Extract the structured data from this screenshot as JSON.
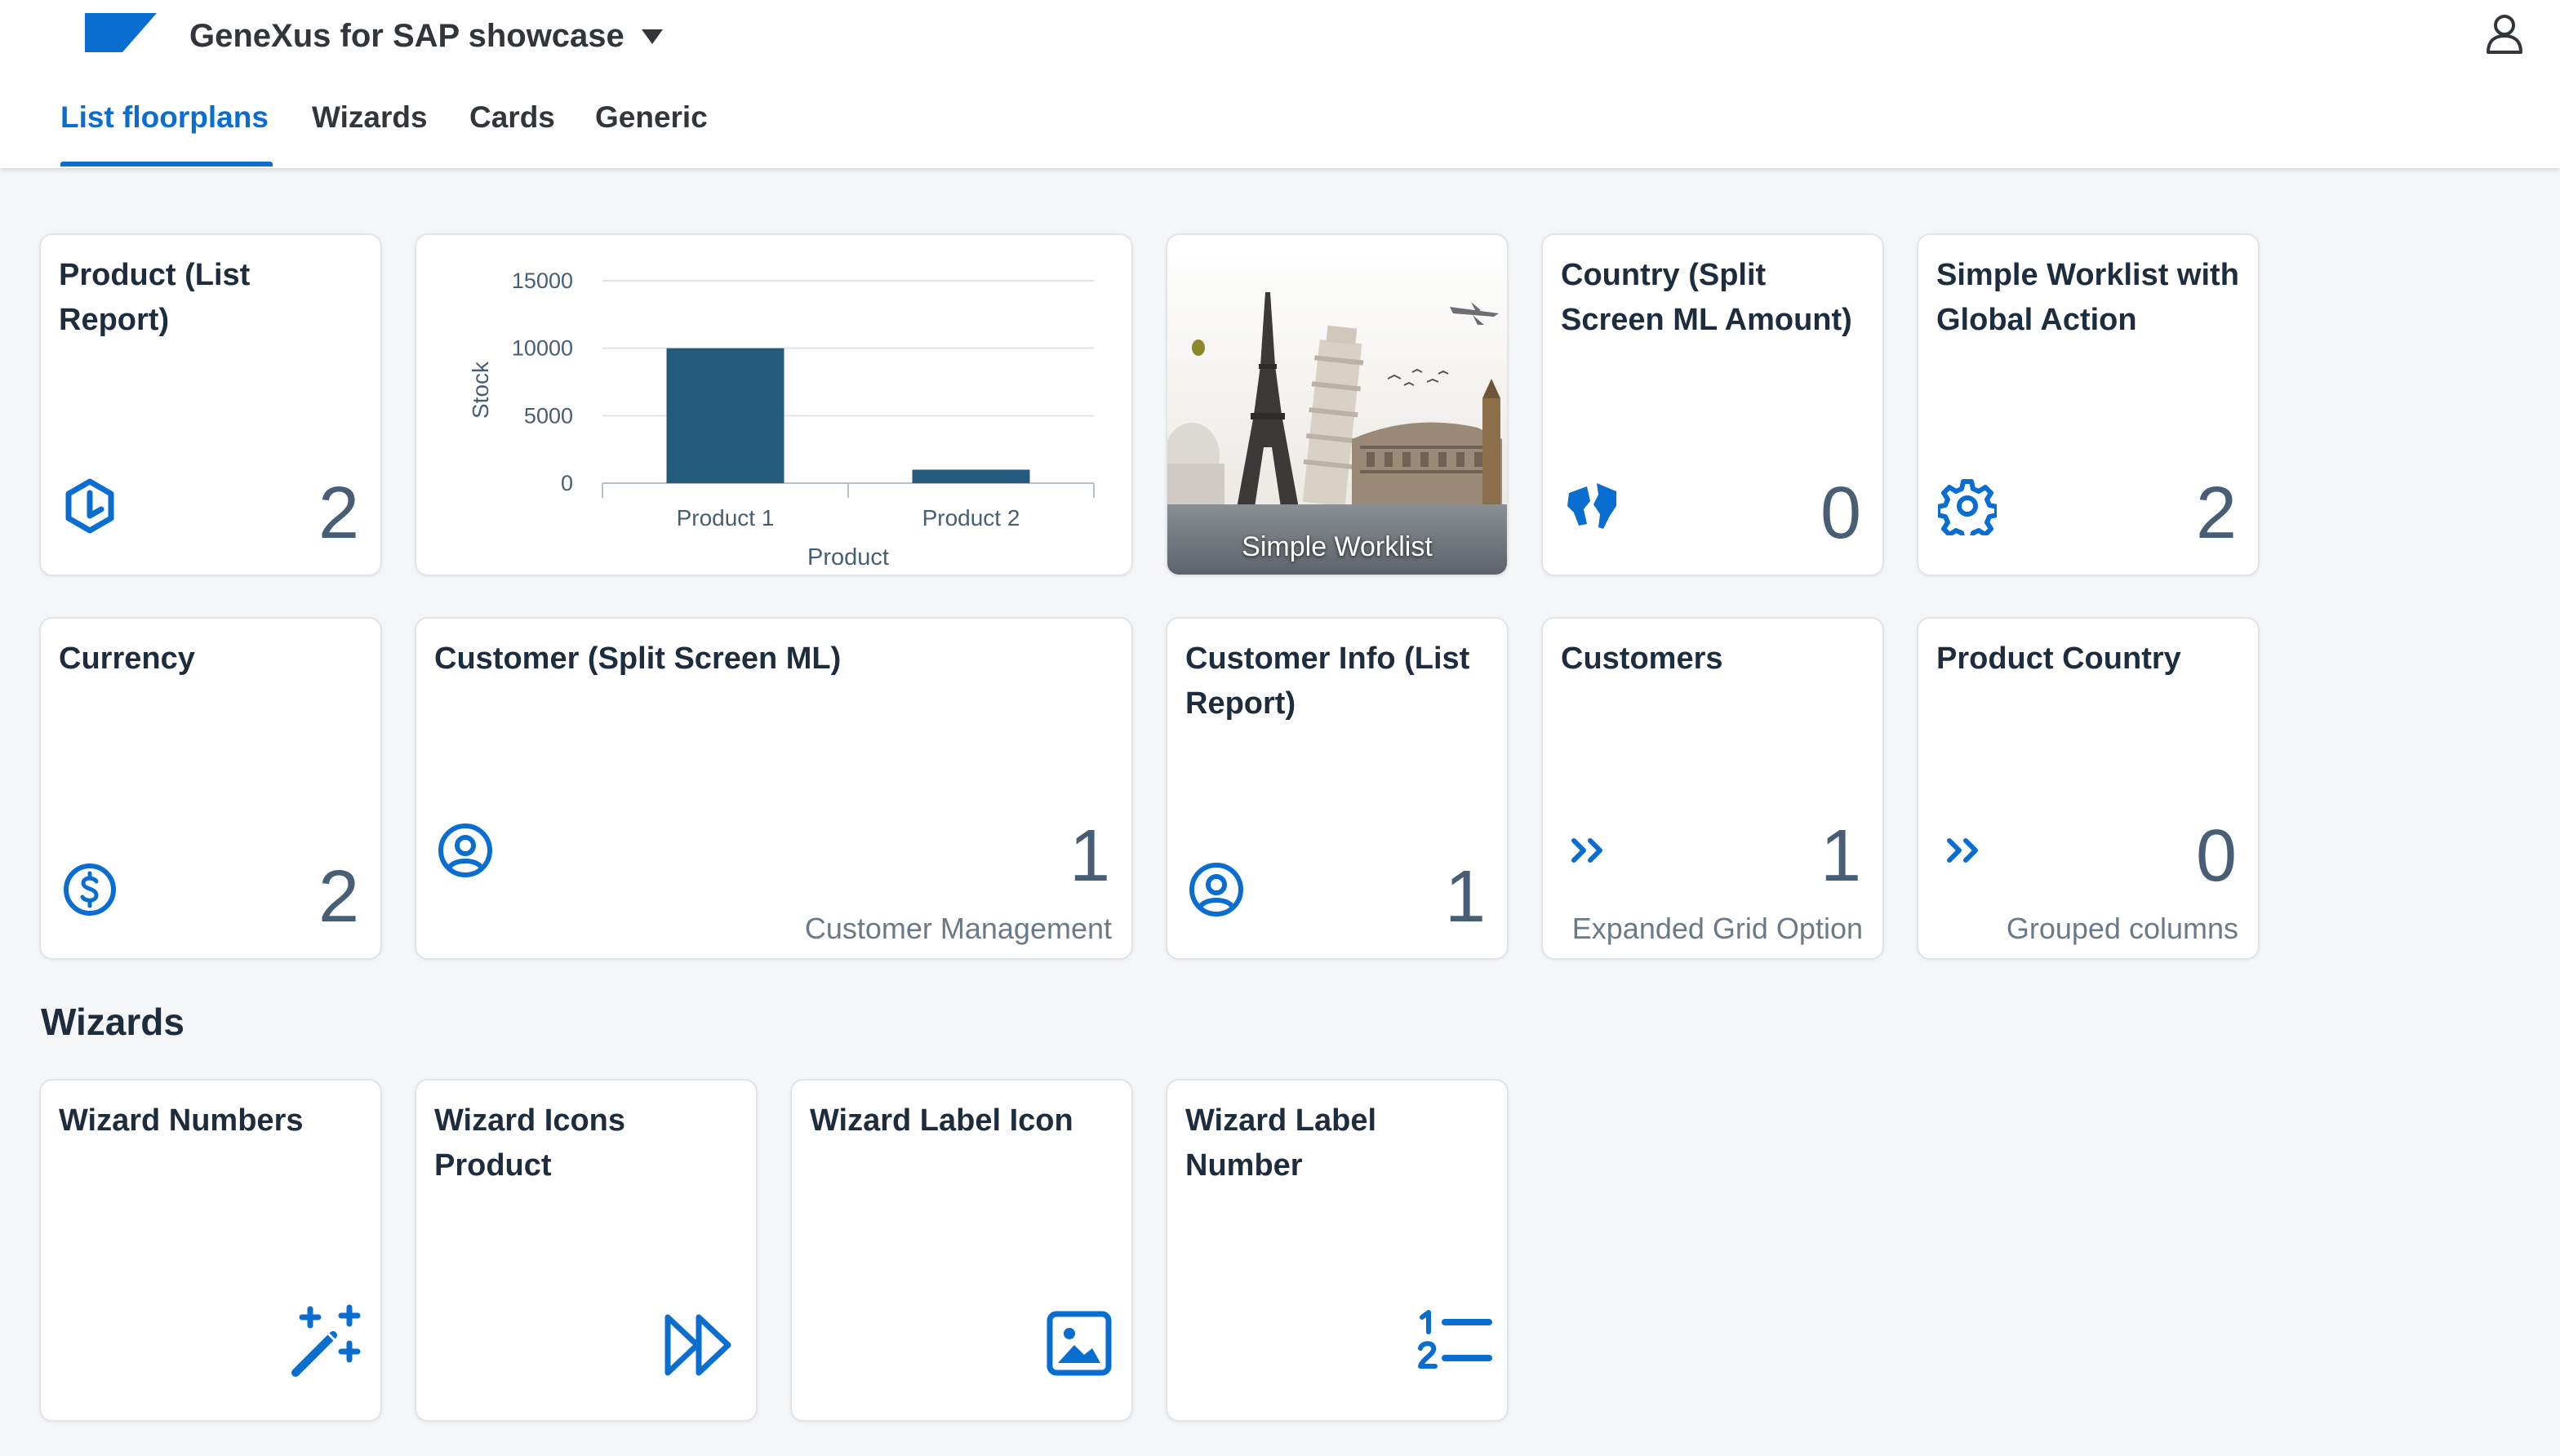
{
  "header": {
    "app_title": "GeneXus for SAP showcase",
    "tabs": [
      {
        "label": "List floorplans",
        "active": true
      },
      {
        "label": "Wizards",
        "active": false
      },
      {
        "label": "Cards",
        "active": false
      },
      {
        "label": "Generic",
        "active": false
      }
    ]
  },
  "tiles": {
    "product_list_report": {
      "title": "Product (List Report)",
      "number": "2",
      "icon": "hexagon-icon"
    },
    "chart": {
      "icon": "bar-chart"
    },
    "simple_worklist": {
      "label": "Simple Worklist",
      "image": "landmarks-photo"
    },
    "country_split": {
      "title": "Country (Split Screen ML Amount)",
      "number": "0",
      "icon": "globe-icon"
    },
    "simple_worklist_global": {
      "title": "Simple Worklist with Global Action",
      "number": "2",
      "icon": "gear-icon"
    },
    "currency": {
      "title": "Currency",
      "number": "2",
      "icon": "dollar-icon"
    },
    "customer_split": {
      "title": "Customer (Split Screen ML)",
      "number": "1",
      "subtitle": "Customer Management",
      "icon": "user-icon"
    },
    "customer_info": {
      "title": "Customer Info (List Report)",
      "number": "1",
      "icon": "user-icon"
    },
    "customers": {
      "title": "Customers",
      "number": "1",
      "subtitle": "Expanded Grid Option",
      "icon": "double-chevron-icon"
    },
    "product_country": {
      "title": "Product Country",
      "number": "0",
      "subtitle": "Grouped columns",
      "icon": "double-chevron-icon"
    }
  },
  "wizards": {
    "section_title": "Wizards",
    "numbers": {
      "title": "Wizard Numbers",
      "icon": "magic-wand-icon"
    },
    "icons_product": {
      "title": "Wizard Icons Product",
      "icon": "fast-forward-icon"
    },
    "label_icon": {
      "title": "Wizard Label Icon",
      "icon": "image-icon"
    },
    "label_number": {
      "title": "Wizard Label Number",
      "icon": "numbered-list-icon"
    }
  },
  "colors": {
    "accent": "#0a6ed1",
    "icon_blue": "#0a6ed1",
    "bar": "#255b7a",
    "text": "#1d2d3e",
    "number": "#475e75"
  },
  "chart_data": {
    "type": "bar",
    "categories": [
      "Product 1",
      "Product 2"
    ],
    "values": [
      10000,
      1000
    ],
    "xlabel": "Product",
    "ylabel": "Stock",
    "ylim": [
      0,
      15000
    ],
    "yticks": [
      0,
      5000,
      10000,
      15000
    ],
    "grid": true
  }
}
